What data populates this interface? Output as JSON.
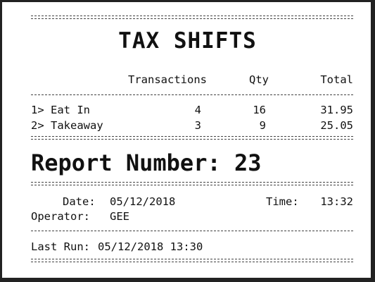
{
  "receipt": {
    "title": "TAX SHIFTS",
    "columns": {
      "transactions": "Transactions",
      "qty": "Qty",
      "total": "Total"
    },
    "rows": [
      {
        "label": "1> Eat In",
        "transactions": "4",
        "qty": "16",
        "total": "31.95"
      },
      {
        "label": "2> Takeaway",
        "transactions": "3",
        "qty": "9",
        "total": "25.05"
      }
    ],
    "report_number": "Report Number: 23",
    "date_label": "Date:",
    "date_value": "05/12/2018",
    "time_label": "Time:",
    "time_value": "13:32",
    "operator_label": "Operator:",
    "operator_value": "GEE",
    "last_run_label": "Last Run:",
    "last_run_value": "05/12/2018 13:30"
  }
}
